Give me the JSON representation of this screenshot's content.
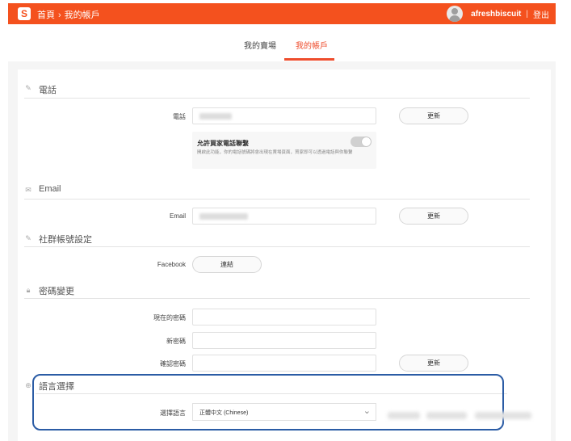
{
  "header": {
    "logo_letter": "S",
    "breadcrumb_home": "首頁",
    "breadcrumb_sep": "›",
    "breadcrumb_current": "我的帳戶",
    "username": "afreshbiscuit",
    "divider": "|",
    "logout": "登出",
    "brand_color": "#f4511e"
  },
  "tabs": {
    "items": [
      {
        "label": "我的賣場"
      },
      {
        "label": "我的帳戶",
        "active": true
      }
    ],
    "active_color": "#ee4d2d"
  },
  "sections": {
    "phone": {
      "icon": "phone-icon",
      "title": "電話",
      "field_label": "電話",
      "change_button": "更新",
      "toggle_title": "允許買家電話聯繫",
      "toggle_desc": "開啟此功能，你的電話號碼將會出現在賣場頁面，買家即可以透過電話與你聯繫",
      "toggle_on": false
    },
    "email": {
      "icon": "mail-icon",
      "title": "Email",
      "field_label": "Email",
      "change_button": "更新"
    },
    "social": {
      "icon": "link-icon",
      "title": "社群帳號設定",
      "facebook_label": "Facebook",
      "connect_button": "連結"
    },
    "password": {
      "icon": "lock-icon",
      "title": "密碼變更",
      "current_label": "現在的密碼",
      "new_label": "新密碼",
      "confirm_label": "確認密碼",
      "update_button": "更新"
    },
    "language": {
      "icon": "globe-icon",
      "title": "語言選擇",
      "select_label": "選擇語言",
      "selected_value": "正體中文 (Chinese)",
      "highlight_color": "#2b5ca5"
    }
  }
}
